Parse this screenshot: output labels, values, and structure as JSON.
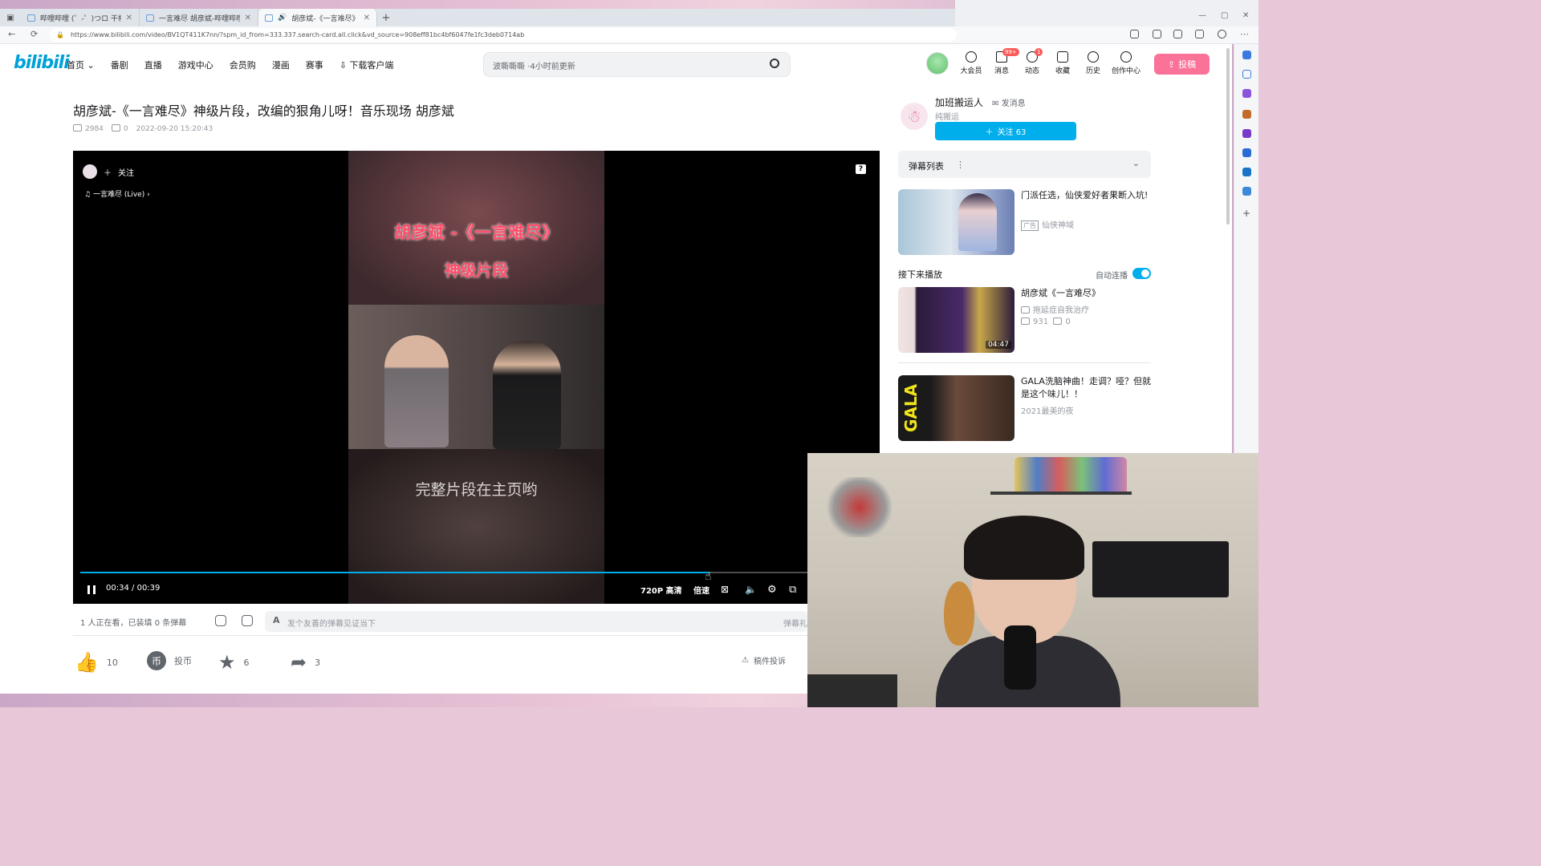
{
  "browser": {
    "tabs": [
      {
        "label": "哔哩哔哩 (゜-゜)つロ 干杯~-bilibili",
        "active": false
      },
      {
        "label": "一言难尽 胡彦斌-哔哩哔哩_Bilibili",
        "active": false
      },
      {
        "label": "胡彦斌-《一言难尽》神级片段",
        "active": true
      }
    ],
    "new_tab": "+",
    "url": "https://www.bilibili.com/video/BV1QT411K7nn/?spm_id_from=333.337.search-card.all.click&vd_source=908eff81bc4bf6047fe1fc3deb0714ab"
  },
  "header": {
    "logo": "bilibili",
    "nav": [
      "首页",
      "番剧",
      "直播",
      "游戏中心",
      "会员购",
      "漫画",
      "赛事",
      "下载客户端"
    ],
    "search_placeholder": "波嘶嘶嘶 ·4小时前更新",
    "icons": [
      {
        "label": "大会员",
        "icon": "vip-icon"
      },
      {
        "label": "消息",
        "icon": "message-icon",
        "badge": "99+"
      },
      {
        "label": "动态",
        "icon": "dynamic-icon",
        "badge": "1"
      },
      {
        "label": "收藏",
        "icon": "star-icon"
      },
      {
        "label": "历史",
        "icon": "history-icon"
      },
      {
        "label": "创作中心",
        "icon": "creator-icon"
      }
    ],
    "upload_label": "投稿"
  },
  "video": {
    "title": "胡彦斌-《一言难尽》神级片段，改编的狠角儿呀！音乐现场 胡彦斌",
    "views": "2984",
    "danmaku_count": "0",
    "date": "2022-09-20 15:20:43"
  },
  "player": {
    "follow_label": "关注",
    "song": "一言难尽 (Live)",
    "help": "?",
    "caption_line1": "胡彦斌 -《一言难尽》",
    "caption_line2": "神级片段",
    "caption_bottom": "完整片段在主页哟",
    "time_current": "00:34",
    "time_sep": "/",
    "time_total": "00:39",
    "progress_fraction": 0.86,
    "quality": "720P 高清",
    "speed": "倍速"
  },
  "danmaku_bar": {
    "status": "1 人正在看，已装填 0 条弹幕",
    "input_placeholder": "发个友善的弹幕见证当下",
    "input_icon": "A",
    "etiquette": "弹幕礼"
  },
  "toolbar": {
    "like": "10",
    "coin": "投币",
    "coin_glyph": "币",
    "fav": "6",
    "share": "3",
    "report": "稿件投诉"
  },
  "uploader": {
    "name": "加班搬运人",
    "message": "发消息",
    "sign": "纯搬运",
    "follow": "关注 63"
  },
  "danmaku_list": {
    "label": "弹幕列表",
    "more": "⋮",
    "chevron": "⌄"
  },
  "ad": {
    "title": "门派任选，仙侠爱好者果断入坑!",
    "tag": "广告",
    "source": "仙侠神域"
  },
  "up_next": {
    "label": "接下来播放",
    "autoplay_label": "自动连播",
    "autoplay": true
  },
  "recommendations": [
    {
      "title": "胡彦斌《一言难尽》",
      "author": "拖延症自我治疗",
      "views": "931",
      "danmaku": "0",
      "duration": "04:47"
    },
    {
      "title": "GALA洗脑神曲！走调？哑？但就是这个味儿！！",
      "author": "2021最美的夜",
      "thumb_text": "GALA"
    }
  ],
  "colors": {
    "brand_blue": "#00aeec",
    "brand_pink": "#fb7299",
    "badge_red": "#fa5a57"
  }
}
